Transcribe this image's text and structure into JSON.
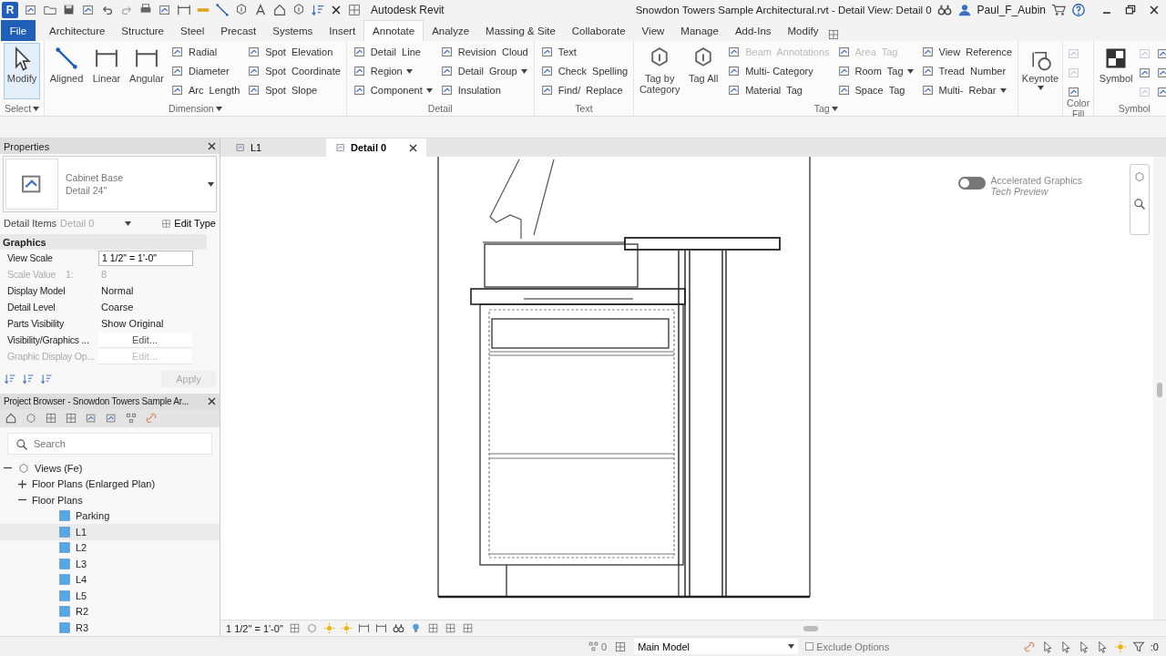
{
  "title_bar": {
    "logo": "R",
    "app_name": "Autodesk Revit",
    "document_title": "Snowdon Towers Sample Architectural.rvt - Detail View: Detail 0",
    "user": "Paul_F_Aubin"
  },
  "ribbon_tabs": [
    {
      "label": "File",
      "kind": "file",
      "selected": false
    },
    {
      "label": "Architecture",
      "kind": "tab",
      "selected": false
    },
    {
      "label": "Structure",
      "kind": "tab",
      "selected": false
    },
    {
      "label": "Steel",
      "kind": "tab",
      "selected": false
    },
    {
      "label": "Precast",
      "kind": "tab",
      "selected": false
    },
    {
      "label": "Systems",
      "kind": "tab",
      "selected": false
    },
    {
      "label": "Insert",
      "kind": "tab",
      "selected": false
    },
    {
      "label": "Annotate",
      "kind": "tab",
      "selected": true
    },
    {
      "label": "Analyze",
      "kind": "tab",
      "selected": false
    },
    {
      "label": "Massing & Site",
      "kind": "tab",
      "selected": false
    },
    {
      "label": "Collaborate",
      "kind": "tab",
      "selected": false
    },
    {
      "label": "View",
      "kind": "tab",
      "selected": false
    },
    {
      "label": "Manage",
      "kind": "tab",
      "selected": false
    },
    {
      "label": "Add-Ins",
      "kind": "tab",
      "selected": false
    },
    {
      "label": "Modify",
      "kind": "tab",
      "selected": false
    }
  ],
  "ribbon_panels": [
    {
      "label": "Select",
      "dropdown": true,
      "columns": [
        {
          "kind": "large",
          "items": [
            {
              "label": "Modify",
              "active": true,
              "dropdown": false,
              "disabled": false
            }
          ]
        }
      ]
    },
    {
      "label": "Dimension",
      "dropdown": true,
      "columns": [
        {
          "kind": "large",
          "items": [
            {
              "label": "Aligned",
              "active": false,
              "dropdown": false,
              "disabled": false
            }
          ]
        },
        {
          "kind": "large",
          "items": [
            {
              "label": "Linear",
              "active": false,
              "dropdown": false,
              "disabled": false
            }
          ]
        },
        {
          "kind": "large",
          "items": [
            {
              "label": "Angular",
              "active": false,
              "dropdown": false,
              "disabled": false
            }
          ]
        },
        {
          "kind": "small",
          "items": [
            {
              "label": "Radial",
              "dropdown": false,
              "disabled": false
            },
            {
              "label": "Diameter",
              "dropdown": false,
              "disabled": false
            },
            {
              "label": "Arc  Length",
              "dropdown": false,
              "disabled": false
            }
          ]
        },
        {
          "kind": "small",
          "items": [
            {
              "label": "Spot  Elevation",
              "dropdown": false,
              "disabled": false
            },
            {
              "label": "Spot  Coordinate",
              "dropdown": false,
              "disabled": false
            },
            {
              "label": "Spot  Slope",
              "dropdown": false,
              "disabled": false
            }
          ]
        }
      ]
    },
    {
      "label": "Detail",
      "dropdown": false,
      "columns": [
        {
          "kind": "small",
          "items": [
            {
              "label": "Detail  Line",
              "dropdown": false,
              "disabled": false
            },
            {
              "label": "Region",
              "dropdown": true,
              "disabled": false
            },
            {
              "label": "Component",
              "dropdown": true,
              "disabled": false
            }
          ]
        },
        {
          "kind": "small",
          "items": [
            {
              "label": "Revision  Cloud",
              "dropdown": false,
              "disabled": false
            },
            {
              "label": "Detail  Group",
              "dropdown": true,
              "disabled": false
            },
            {
              "label": "Insulation",
              "dropdown": false,
              "disabled": false
            }
          ]
        }
      ]
    },
    {
      "label": "Text",
      "dropdown": false,
      "columns": [
        {
          "kind": "small",
          "items": [
            {
              "label": "Text",
              "dropdown": false,
              "disabled": false
            },
            {
              "label": "Check  Spelling",
              "dropdown": false,
              "disabled": false
            },
            {
              "label": "Find/  Replace",
              "dropdown": false,
              "disabled": false
            }
          ]
        }
      ]
    },
    {
      "label": "Tag",
      "dropdown": true,
      "columns": [
        {
          "kind": "large",
          "items": [
            {
              "label": "Tag by Category",
              "active": false,
              "dropdown": false,
              "disabled": false
            }
          ]
        },
        {
          "kind": "large",
          "items": [
            {
              "label": "Tag All",
              "active": false,
              "dropdown": false,
              "disabled": false
            }
          ]
        },
        {
          "kind": "small",
          "items": [
            {
              "label": "Beam  Annotations",
              "dropdown": false,
              "disabled": true
            },
            {
              "label": "Multi- Category",
              "dropdown": false,
              "disabled": false
            },
            {
              "label": "Material  Tag",
              "dropdown": false,
              "disabled": false
            }
          ]
        },
        {
          "kind": "small",
          "items": [
            {
              "label": "Area  Tag",
              "dropdown": false,
              "disabled": true
            },
            {
              "label": "Room  Tag",
              "dropdown": true,
              "disabled": false
            },
            {
              "label": "Space  Tag",
              "dropdown": false,
              "disabled": false
            }
          ]
        },
        {
          "kind": "small",
          "items": [
            {
              "label": "View  Reference",
              "dropdown": false,
              "disabled": false
            },
            {
              "label": "Tread  Number",
              "dropdown": false,
              "disabled": false
            },
            {
              "label": "Multi-  Rebar",
              "dropdown": true,
              "disabled": false
            }
          ]
        }
      ]
    },
    {
      "columns": [
        {
          "kind": "large",
          "items": [
            {
              "label": "Keynote",
              "active": false,
              "dropdown": true,
              "disabled": false
            }
          ]
        }
      ]
    },
    {
      "label": "Color Fill",
      "dropdown": false,
      "columns": [
        {
          "kind": "icons",
          "items": [
            {
              "disabled": true
            },
            {
              "disabled": true
            },
            {
              "disabled": false
            }
          ]
        }
      ]
    },
    {
      "label": "Symbol",
      "dropdown": false,
      "columns": [
        {
          "kind": "large",
          "items": [
            {
              "label": "Symbol",
              "active": false,
              "dropdown": false,
              "disabled": false
            }
          ]
        },
        {
          "kind": "icons",
          "items": [
            {
              "disabled": true
            },
            {
              "disabled": false
            },
            {
              "disabled": true
            }
          ]
        },
        {
          "kind": "icons",
          "items": [
            {
              "disabled": false
            },
            {
              "disabled": false
            },
            {
              "disabled": false
            }
          ]
        }
      ]
    }
  ],
  "properties": {
    "title": "Properties",
    "type_name": "Cabinet Base",
    "type_size": "Detail 24\"",
    "instance_filter": "Detail Items",
    "instance_view": "Detail 0",
    "edit_type": "Edit Type",
    "section": "Graphics",
    "rows": [
      {
        "name": "View Scale",
        "value": "1 1/2\" = 1'-0\"",
        "kind": "field",
        "disabled": false
      },
      {
        "name": "Scale Value    1:",
        "value": "8",
        "kind": "text",
        "disabled": true
      },
      {
        "name": "Display Model",
        "value": "Normal",
        "kind": "text",
        "disabled": false
      },
      {
        "name": "Detail Level",
        "value": "Coarse",
        "kind": "text",
        "disabled": false
      },
      {
        "name": "Parts Visibility",
        "value": "Show Original",
        "kind": "text",
        "disabled": false
      },
      {
        "name": "Visibility/Graphics ...",
        "value": "Edit...",
        "kind": "button",
        "disabled": false
      },
      {
        "name": "Graphic Display Op...",
        "value": "Edit...",
        "kind": "button",
        "disabled": true
      }
    ],
    "apply": "Apply"
  },
  "project_browser": {
    "title": "Project Browser - Snowdon Towers Sample Ar...",
    "search": {
      "placeholder": "Search"
    },
    "tree": [
      {
        "label": "Views (Fe)",
        "kind": "views",
        "expanded": true,
        "selected": false,
        "children": [
          {
            "label": "Floor Plans (Enlarged Plan)",
            "kind": "group",
            "expanded": false,
            "selected": false
          },
          {
            "label": "Floor Plans",
            "kind": "group",
            "expanded": true,
            "selected": false,
            "children": [
              {
                "label": "Parking",
                "kind": "plan",
                "selected": false
              },
              {
                "label": "L1",
                "kind": "plan",
                "selected": true
              },
              {
                "label": "L2",
                "kind": "plan",
                "selected": false
              },
              {
                "label": "L3",
                "kind": "plan",
                "selected": false
              },
              {
                "label": "L4",
                "kind": "plan",
                "selected": false
              },
              {
                "label": "L5",
                "kind": "plan",
                "selected": false
              },
              {
                "label": "R2",
                "kind": "plan",
                "selected": false
              },
              {
                "label": "R3",
                "kind": "plan",
                "selected": false
              }
            ]
          }
        ]
      }
    ]
  },
  "view_tabs": [
    {
      "label": "L1",
      "selected": false
    },
    {
      "label": "Detail 0",
      "selected": true
    }
  ],
  "graphics_toggle": {
    "on": false,
    "title": "Accelerated Graphics",
    "subtitle": "Tech Preview"
  },
  "view_control_bar": {
    "scale": "1 1/2\" = 1'-0\""
  },
  "status_bar": {
    "selection_count": "0",
    "model": "Main Model",
    "exclude_options": {
      "label": "Exclude Options",
      "checked": false
    },
    "filter_count": ":0"
  }
}
